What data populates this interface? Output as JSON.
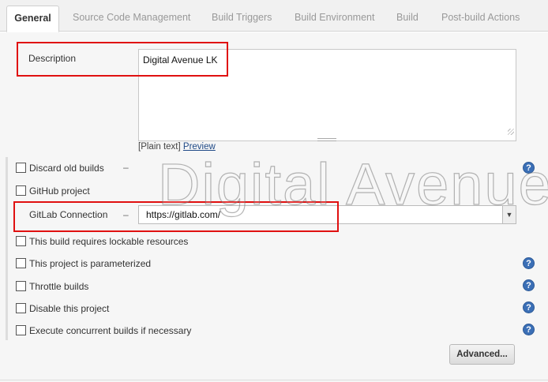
{
  "tabs": [
    {
      "label": "General",
      "active": true
    },
    {
      "label": "Source Code Management"
    },
    {
      "label": "Build Triggers"
    },
    {
      "label": "Build Environment"
    },
    {
      "label": "Build"
    },
    {
      "label": "Post-build Actions"
    }
  ],
  "description": {
    "label": "Description",
    "value": "Digital Avenue LK",
    "plain_text": "[Plain text]",
    "preview_link": "Preview"
  },
  "options": {
    "discard_old_builds": "Discard old builds",
    "github_project": "GitHub project",
    "gitlab_connection": "GitLab Connection",
    "gitlab_connection_value": "https://gitlab.com/",
    "lockable_resources": "This build requires lockable resources",
    "parameterized": "This project is parameterized",
    "throttle": "Throttle builds",
    "disable": "Disable this project",
    "concurrent": "Execute concurrent builds if necessary"
  },
  "help_glyph": "?",
  "advanced_button": "Advanced...",
  "watermark": "Digital Avenue ©",
  "colors": {
    "highlight": "#e01010",
    "help_icon": "#3b6fb6",
    "link": "#204a87"
  }
}
